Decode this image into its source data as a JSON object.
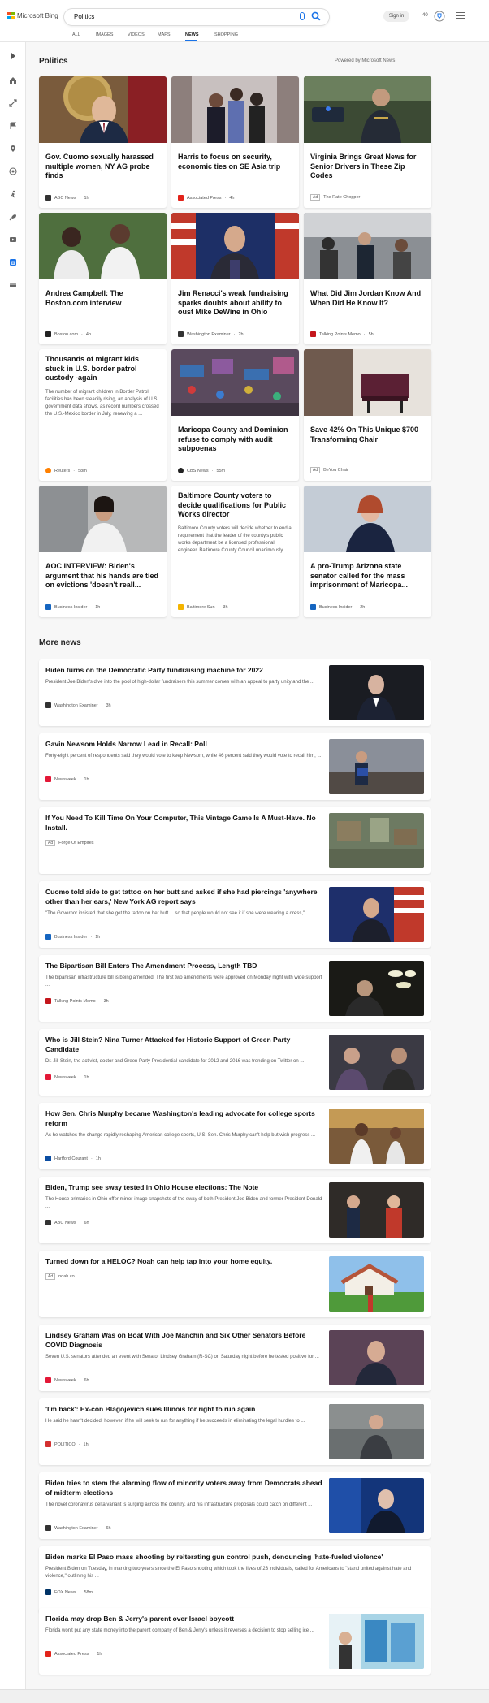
{
  "header": {
    "brand": "Microsoft Bing",
    "query": "Politics",
    "signin": "Sign in",
    "points": "40",
    "tabs": [
      "ALL",
      "IMAGES",
      "VIDEOS",
      "MAPS",
      "NEWS",
      "SHOPPING"
    ],
    "active_tab": "NEWS"
  },
  "politics": {
    "title": "Politics",
    "powered": "Powered by Microsoft News",
    "cards": [
      {
        "title": "Gov. Cuomo sexually harassed multiple women, NY AG probe finds",
        "snippet": "",
        "source": "ABC News",
        "time": "1h",
        "ad": false
      },
      {
        "title": "Harris to focus on security, economic ties on SE Asia trip",
        "snippet": "",
        "source": "Associated Press",
        "time": "4h",
        "ad": false
      },
      {
        "title": "Virginia Brings Great News for Senior Drivers in These Zip Codes",
        "snippet": "",
        "source": "The Rate Chopper",
        "time": "",
        "ad": true
      },
      {
        "title": "Andrea Campbell: The Boston.com interview",
        "snippet": "",
        "source": "Boston.com",
        "time": "4h",
        "ad": false
      },
      {
        "title": "Jim Renacci's weak fundraising sparks doubts about ability to oust Mike DeWine in Ohio",
        "snippet": "",
        "source": "Washington Examiner",
        "time": "2h",
        "ad": false
      },
      {
        "title": "What Did Jim Jordan Know And When Did He Know It?",
        "snippet": "",
        "source": "Talking Points Memo",
        "time": "5h",
        "ad": false
      },
      {
        "title": "Thousands of migrant kids stuck in U.S. border patrol custody -again",
        "snippet": "The number of migrant children in Border Patrol facilities has been steadily rising, an analysis of U.S. government data shows, as record numbers crossed the U.S.-Mexico border in July, renewing a ...",
        "source": "Reuters",
        "time": "58m",
        "ad": false
      },
      {
        "title": "Maricopa County and Dominion refuse to comply with audit subpoenas",
        "snippet": "",
        "source": "CBS News",
        "time": "55m",
        "ad": false
      },
      {
        "title": "Save 42% On This Unique $700 Transforming Chair",
        "snippet": "",
        "source": "BeYou Chair",
        "time": "",
        "ad": true
      },
      {
        "title": "AOC INTERVIEW: Biden's argument that his hands are tied on evictions 'doesn't reall...",
        "snippet": "",
        "source": "Business Insider",
        "time": "1h",
        "ad": false
      },
      {
        "title": "Baltimore County voters to decide qualifications for Public Works director",
        "snippet": "Baltimore County voters will decide whether to end a requirement that the leader of the county's public works department be a licensed professional engineer. Baltimore County Council unanimously ...",
        "source": "Baltimore Sun",
        "time": "3h",
        "ad": false
      },
      {
        "title": "A pro-Trump Arizona state senator called for the mass imprisonment of Maricopa...",
        "snippet": "",
        "source": "Business Insider",
        "time": "2h",
        "ad": false
      }
    ]
  },
  "more_news": {
    "title": "More news",
    "items": [
      {
        "title": "Biden turns on the Democratic Party fundraising machine for 2022",
        "snippet": "President Joe Biden's dive into the pool of high-dollar fundraisers this summer comes with an appeal to party unity and the ...",
        "source": "Washington Examiner",
        "time": "3h",
        "ad": false
      },
      {
        "title": "Gavin Newsom Holds Narrow Lead in Recall: Poll",
        "snippet": "Forty-eight percent of respondents said they would vote to keep Newsom, while 46 percent said they would vote to recall him, ...",
        "source": "Newsweek",
        "time": "1h",
        "ad": false
      },
      {
        "title": "If You Need To Kill Time On Your Computer, This Vintage Game Is A Must-Have. No Install.",
        "snippet": "",
        "source": "Forge Of Empires",
        "time": "",
        "ad": true
      },
      {
        "title": "Cuomo told aide to get tattoo on her butt and asked if she had piercings 'anywhere other than her ears,' New York AG report says",
        "snippet": "\"The Governor insisted that she get the tattoo on her butt ... so that people would not see it if she were wearing a dress,\" ...",
        "source": "Business Insider",
        "time": "1h",
        "ad": false
      },
      {
        "title": "The Bipartisan Bill Enters The Amendment Process, Length TBD",
        "snippet": "The bipartisan infrastructure bill is being amended. The first two amendments were approved on Monday night with wide support ...",
        "source": "Talking Points Memo",
        "time": "3h",
        "ad": false
      },
      {
        "title": "Who is Jill Stein? Nina Turner Attacked for Historic Support of Green Party Candidate",
        "snippet": "Dr. Jill Stein, the activist, doctor and Green Party Presidential candidate for 2012 and 2016 was trending on Twitter on ...",
        "source": "Newsweek",
        "time": "1h",
        "ad": false
      },
      {
        "title": "How Sen. Chris Murphy became Washington's leading advocate for college sports reform",
        "snippet": "As he watches the change rapidly reshaping American college sports, U.S. Sen. Chris Murphy can't help but wish progress ...",
        "source": "Hartford Courant",
        "time": "1h",
        "ad": false
      },
      {
        "title": "Biden, Trump see sway tested in Ohio House elections: The Note",
        "snippet": "The House primaries in Ohio offer mirror-image snapshots of the sway of both President Joe Biden and former President Donald ...",
        "source": "ABC News",
        "time": "6h",
        "ad": false
      },
      {
        "title": "Turned down for a HELOC? Noah can help tap into your home equity.",
        "snippet": "",
        "source": "noah.co",
        "time": "",
        "ad": true
      },
      {
        "title": "Lindsey Graham Was on Boat With Joe Manchin and Six Other Senators Before COVID Diagnosis",
        "snippet": "Seven U.S. senators attended an event with Senator Lindsey Graham (R-SC) on Saturday night before he tested positive for ...",
        "source": "Newsweek",
        "time": "6h",
        "ad": false
      },
      {
        "title": "'I'm back': Ex-con Blagojevich sues Illinois for right to run again",
        "snippet": "He said he hasn't decided, however, if he will seek to run for anything if he succeeds in eliminating the legal hurdles to ...",
        "source": "POLITICO",
        "time": "1h",
        "ad": false
      },
      {
        "title": "Biden tries to stem the alarming flow of minority voters away from Democrats ahead of midterm elections",
        "snippet": "The novel coronavirus delta variant is surging across the country, and his infrastructure proposals could catch on different ...",
        "source": "Washington Examiner",
        "time": "6h",
        "ad": false
      },
      {
        "title": "Biden marks El Paso mass shooting by reiterating gun control push, denouncing 'hate-fueled violence'",
        "snippet": "President Biden on Tuesday, in marking two years since the El Paso shooting which took the lives of 23 individuals, called for Americans to \"stand united against hate and violence,\" outlining his ...",
        "source": "FOX News",
        "time": "58m",
        "ad": false
      },
      {
        "title": "Florida may drop Ben & Jerry's parent over Israel boycott",
        "snippet": "Florida won't put any state money into the parent company of Ben & Jerry's unless it reverses a decision to stop selling ice ...",
        "source": "Associated Press",
        "time": "1h",
        "ad": false
      }
    ]
  },
  "colors": {
    "accent": "#1a73e8",
    "abc": "#333333",
    "ap": "#e2231a",
    "newsweek": "#e31837",
    "tpm": "#c4161c",
    "reuters": "#ff8000",
    "cbs": "#222222",
    "bi": "#1565c0",
    "balt": "#f4b400",
    "politico": "#d32f2f",
    "fox": "#003366",
    "hartford": "#0b4da2",
    "washex": "#333333"
  }
}
